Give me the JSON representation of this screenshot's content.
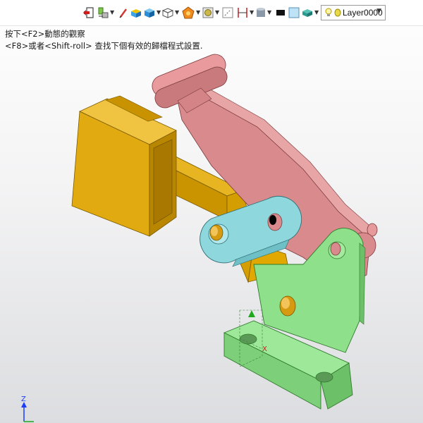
{
  "toolbar": {
    "layer": {
      "value": "Layer0000"
    },
    "icons": [
      "exit-icon",
      "tools-icon",
      "pen-icon",
      "shade-icon",
      "cube-icon",
      "wireframe-icon",
      "render-icon",
      "view-icon",
      "dimension-icon",
      "cylinder-icon",
      "color-icon",
      "face-icon",
      "surface-icon",
      "bulb-icon"
    ]
  },
  "hint": {
    "line1": "按下<F2>動態的觀察",
    "line2": "<F8>或者<Shift-roll> 查找下個有效的歸檔程式設置."
  },
  "triad": {
    "z_label": "Z",
    "x_label": "X"
  },
  "colors": {
    "part_yellow": "#d9a400",
    "part_pink": "#d98a8c",
    "part_cyan": "#8ed7dd",
    "part_green": "#8ee08a",
    "pin_gold": "#d59a10",
    "triad_blue": "#1a3cff",
    "triad_green": "#1fa91f"
  }
}
